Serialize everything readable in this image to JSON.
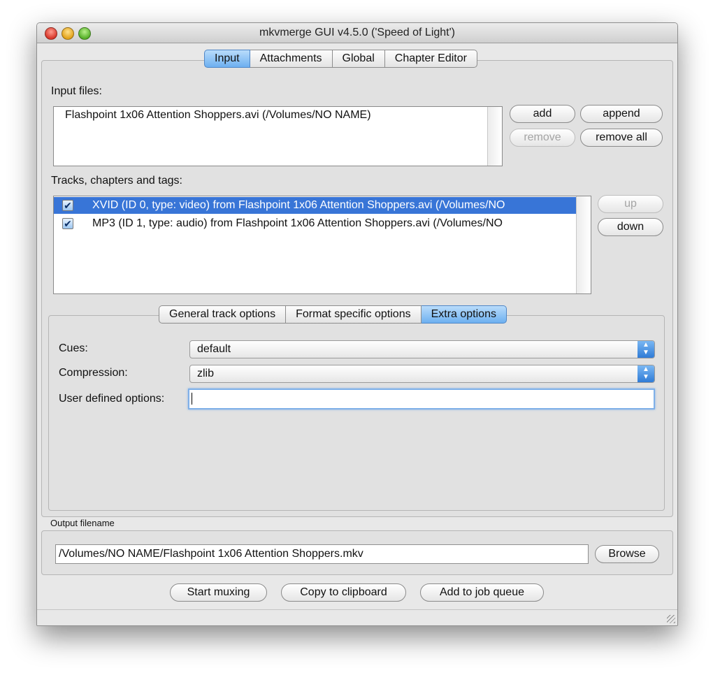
{
  "window": {
    "title": "mkvmerge GUI v4.5.0 ('Speed of Light')"
  },
  "main_tabs": [
    {
      "label": "Input",
      "active": true
    },
    {
      "label": "Attachments",
      "active": false
    },
    {
      "label": "Global",
      "active": false
    },
    {
      "label": "Chapter Editor",
      "active": false
    }
  ],
  "input": {
    "files_label": "Input files:",
    "files": [
      "Flashpoint 1x06 Attention Shoppers.avi (/Volumes/NO NAME)"
    ],
    "buttons": {
      "add": "add",
      "append": "append",
      "remove": "remove",
      "remove_all": "remove all"
    },
    "tracks_label": "Tracks, chapters and tags:",
    "tracks": [
      {
        "label": "XVID (ID 0, type: video) from Flashpoint 1x06 Attention Shoppers.avi (/Volumes/NO",
        "checked": true,
        "selected": true
      },
      {
        "label": "MP3 (ID 1, type: audio) from Flashpoint 1x06 Attention Shoppers.avi (/Volumes/NO",
        "checked": true,
        "selected": false
      }
    ],
    "track_buttons": {
      "up": "up",
      "down": "down"
    }
  },
  "sub_tabs": [
    {
      "label": "General track options",
      "active": false
    },
    {
      "label": "Format specific options",
      "active": false
    },
    {
      "label": "Extra options",
      "active": true
    }
  ],
  "extra": {
    "cues_label": "Cues:",
    "cues_value": "default",
    "compression_label": "Compression:",
    "compression_value": "zlib",
    "user_label": "User defined options:",
    "user_value": ""
  },
  "output": {
    "label": "Output filename",
    "value": "/Volumes/NO NAME/Flashpoint 1x06 Attention Shoppers.mkv",
    "browse": "Browse"
  },
  "actions": {
    "start": "Start muxing",
    "copy": "Copy to clipboard",
    "queue": "Add to job queue"
  },
  "colors": {
    "selection": "#3875d7",
    "accent": "#6db0f0"
  }
}
